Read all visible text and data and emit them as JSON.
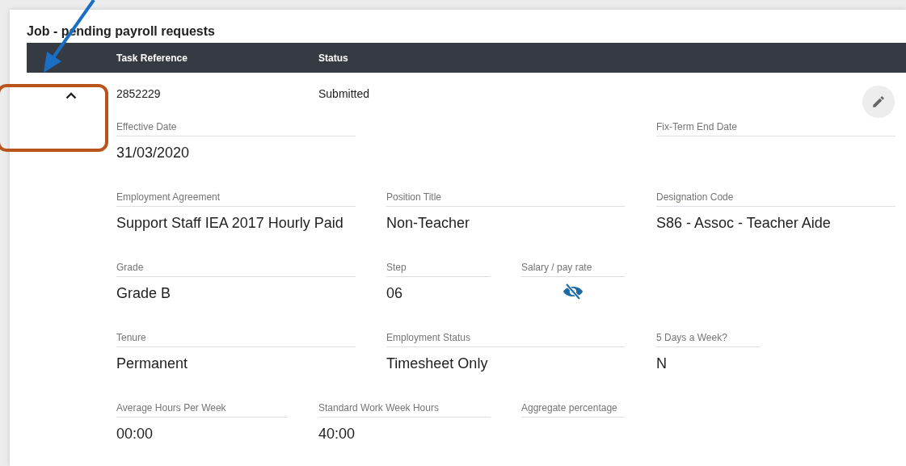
{
  "title": "Job - pending payroll requests",
  "table": {
    "columns": [
      "Task Reference",
      "Status"
    ],
    "rows": [
      {
        "task_reference": "2852229",
        "status": "Submitted",
        "expanded": true,
        "detail_rows": [
          [
            {
              "label": "Effective Date",
              "value": "31/03/2020",
              "kind": "text"
            },
            {
              "label": "Fix-Term End Date",
              "kind": "text"
            }
          ],
          [
            {
              "label": "Employment Agreement",
              "value": "Support Staff IEA 2017 Hourly Paid",
              "kind": "text"
            },
            {
              "label": "Position Title",
              "value": "Non-Teacher",
              "kind": "text"
            },
            {
              "label": "Designation Code",
              "value": "S86 - Assoc - Teacher Aide",
              "kind": "text"
            }
          ],
          [
            {
              "label": "Grade",
              "value": "Grade B",
              "kind": "text"
            },
            {
              "label": "Step",
              "value": "06",
              "kind": "text"
            },
            {
              "label": "Salary / pay rate",
              "kind": "hidden"
            }
          ],
          [
            {
              "label": "Tenure",
              "value": "Permanent",
              "kind": "text"
            },
            {
              "label": "Employment Status",
              "value": "Timesheet Only",
              "kind": "text"
            },
            {
              "label": "5 Days a Week?",
              "value": "N",
              "kind": "text"
            }
          ],
          [
            {
              "label": "Average Hours Per Week",
              "value": "00:00",
              "kind": "text"
            },
            {
              "label": "Standard Work Week Hours",
              "value": "40:00",
              "kind": "text"
            },
            {
              "label": "Aggregate percentage",
              "kind": "text"
            }
          ]
        ]
      }
    ]
  },
  "annotations": {
    "highlight_frame": true,
    "pointer_arrow": true
  }
}
